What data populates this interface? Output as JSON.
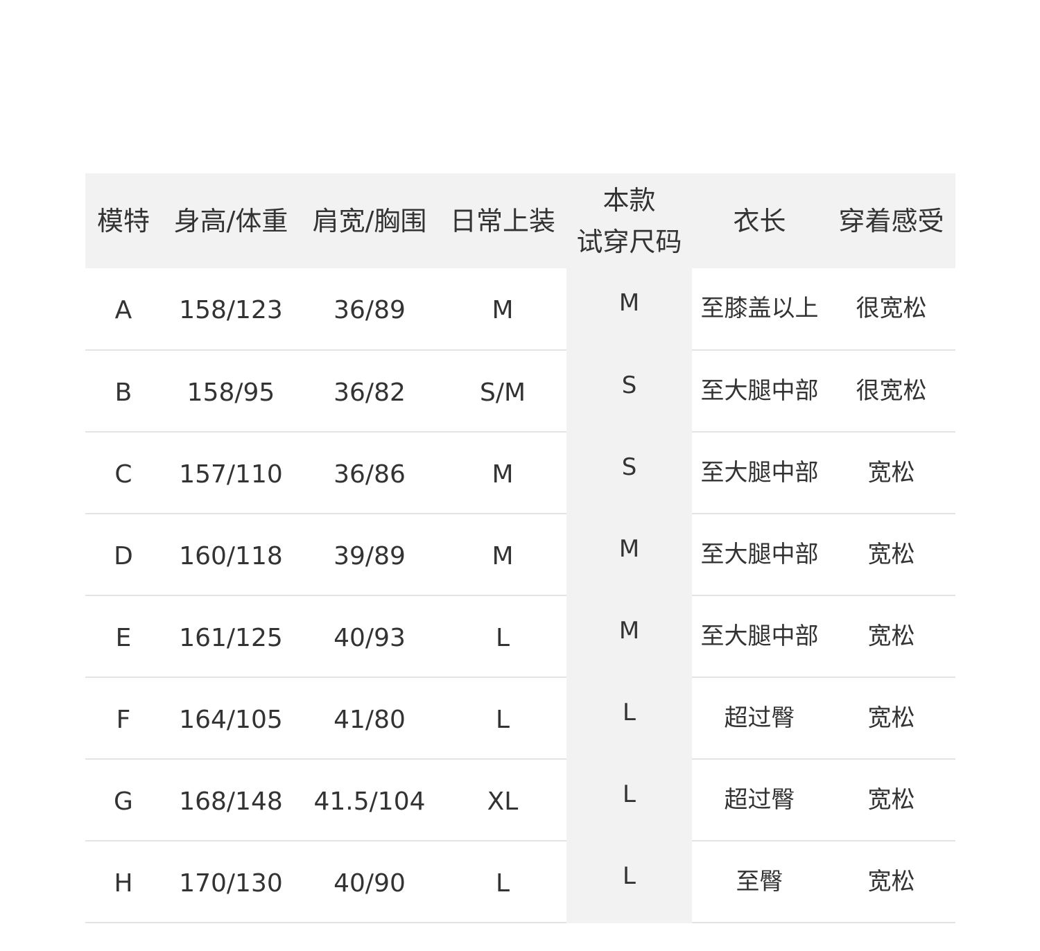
{
  "table": {
    "headers": {
      "model": "模特",
      "height_weight": "身高/体重",
      "shoulder_chest": "肩宽/胸围",
      "daily_size": "日常上装",
      "try_size_line1": "本款",
      "try_size_line2": "试穿尺码",
      "length": "衣长",
      "feel": "穿着感受"
    },
    "rows": [
      {
        "model": "A",
        "height_weight": "158/123",
        "shoulder_chest": "36/89",
        "daily_size": "M",
        "try_size": "M",
        "length": "至膝盖以上",
        "feel": "很宽松"
      },
      {
        "model": "B",
        "height_weight": "158/95",
        "shoulder_chest": "36/82",
        "daily_size": "S/M",
        "try_size": "S",
        "length": "至大腿中部",
        "feel": "很宽松"
      },
      {
        "model": "C",
        "height_weight": "157/110",
        "shoulder_chest": "36/86",
        "daily_size": "M",
        "try_size": "S",
        "length": "至大腿中部",
        "feel": "宽松"
      },
      {
        "model": "D",
        "height_weight": "160/118",
        "shoulder_chest": "39/89",
        "daily_size": "M",
        "try_size": "M",
        "length": "至大腿中部",
        "feel": "宽松"
      },
      {
        "model": "E",
        "height_weight": "161/125",
        "shoulder_chest": "40/93",
        "daily_size": "L",
        "try_size": "M",
        "length": "至大腿中部",
        "feel": "宽松"
      },
      {
        "model": "F",
        "height_weight": "164/105",
        "shoulder_chest": "41/80",
        "daily_size": "L",
        "try_size": "L",
        "length": "超过臀",
        "feel": "宽松"
      },
      {
        "model": "G",
        "height_weight": "168/148",
        "shoulder_chest": "41.5/104",
        "daily_size": "XL",
        "try_size": "L",
        "length": "超过臀",
        "feel": "宽松"
      },
      {
        "model": "H",
        "height_weight": "170/130",
        "shoulder_chest": "40/90",
        "daily_size": "L",
        "try_size": "L",
        "length": "至臀",
        "feel": "宽松"
      }
    ]
  },
  "colors": {
    "text": "#333333",
    "header_bg": "#f2f2f2",
    "highlight_column_bg": "#f2f2f2",
    "row_divider": "#e3e3e3"
  }
}
